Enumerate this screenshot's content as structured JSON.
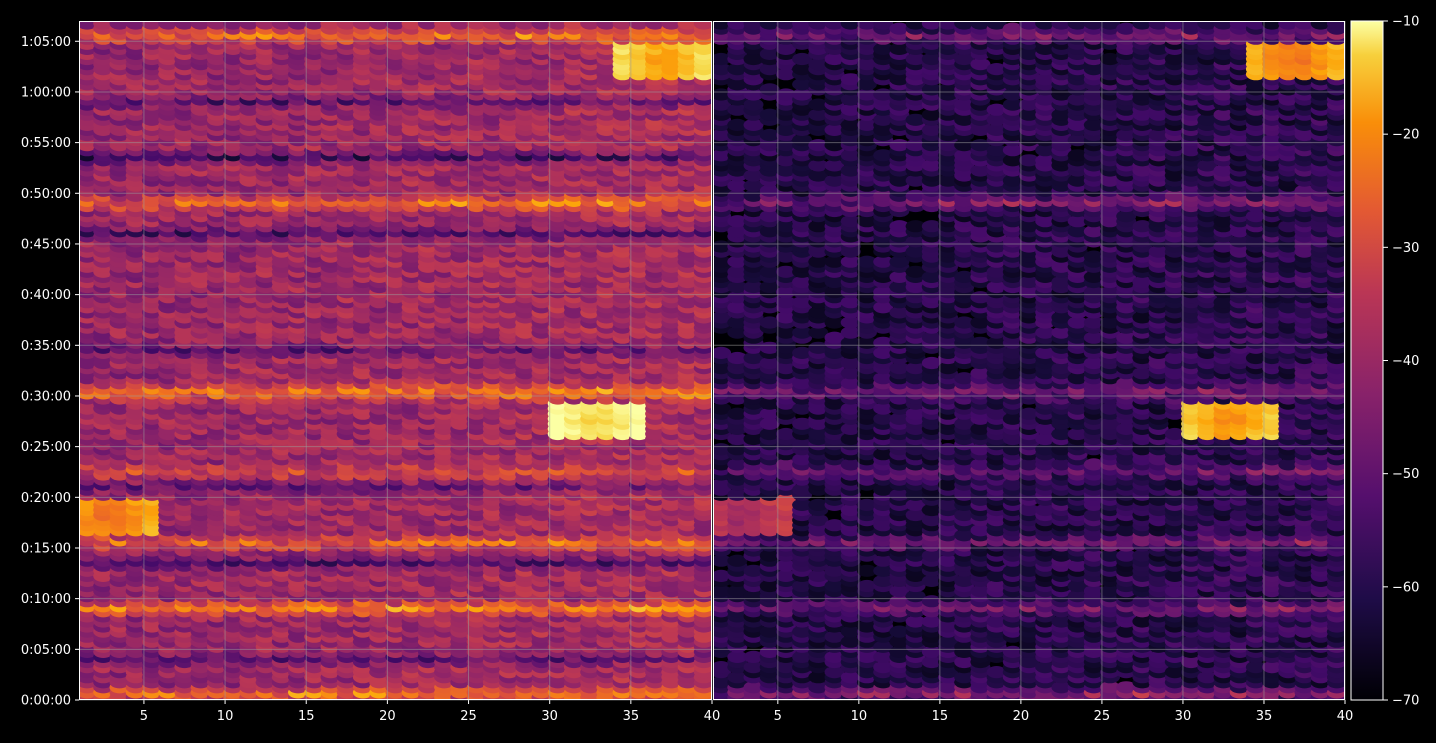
{
  "chart_data": [
    {
      "type": "heatmap",
      "panel": "left",
      "title": "",
      "xlabel": "",
      "ylabel": "",
      "xlim": [
        1,
        40
      ],
      "ylim_seconds": [
        0,
        4020
      ],
      "x_ticks": [
        5,
        10,
        15,
        20,
        25,
        30,
        35,
        40
      ],
      "x_tick_labels": [
        "5",
        "10",
        "15",
        "20",
        "25",
        "30",
        "35",
        "40"
      ],
      "y_ticks_seconds": [
        0,
        300,
        600,
        900,
        1200,
        1500,
        1800,
        2100,
        2400,
        2700,
        3000,
        3300,
        3600,
        3900
      ],
      "y_tick_labels": [
        "0:00:00",
        "0:05:00",
        "0:10:00",
        "0:15:00",
        "0:20:00",
        "0:25:00",
        "0:30:00",
        "0:35:00",
        "0:40:00",
        "0:45:00",
        "0:50:00",
        "0:55:00",
        "1:00:00",
        "1:05:00"
      ],
      "grid": true,
      "value_range": [
        -70,
        -10
      ],
      "baseline": -46,
      "time_events": [
        {
          "time": "0:00:30",
          "delta": 18
        },
        {
          "time": "0:09:00",
          "delta": 20
        },
        {
          "time": "0:15:30",
          "delta": 14
        },
        {
          "time": "0:22:30",
          "delta": 10
        },
        {
          "time": "0:30:20",
          "delta": 20
        },
        {
          "time": "0:49:00",
          "delta": 16
        },
        {
          "time": "1:05:30",
          "delta": 16
        }
      ],
      "low_bands": [
        {
          "time": "0:04:00",
          "delta": -10
        },
        {
          "time": "0:13:30",
          "delta": -12
        },
        {
          "time": "0:21:00",
          "delta": -8
        },
        {
          "time": "0:34:30",
          "delta": -9
        },
        {
          "time": "0:46:00",
          "delta": -12
        },
        {
          "time": "0:53:30",
          "delta": -14
        },
        {
          "time": "0:59:00",
          "delta": -10
        }
      ],
      "hotspots": [
        {
          "x": 33,
          "time": "0:27:30",
          "value": -20
        },
        {
          "x": 3,
          "time": "0:18:00",
          "value": -32
        },
        {
          "x": 37,
          "time": "1:03:00",
          "value": -26
        }
      ]
    },
    {
      "type": "heatmap",
      "panel": "right",
      "title": "",
      "xlabel": "",
      "ylabel": "",
      "xlim": [
        1,
        40
      ],
      "ylim_seconds": [
        0,
        4020
      ],
      "x_ticks": [
        5,
        10,
        15,
        20,
        25,
        30,
        35,
        40
      ],
      "x_tick_labels": [
        "5",
        "10",
        "15",
        "20",
        "25",
        "30",
        "35",
        "40"
      ],
      "grid": true,
      "value_range": [
        -70,
        -10
      ],
      "baseline": -64,
      "time_events": [
        {
          "time": "0:00:30",
          "delta": 16
        },
        {
          "time": "0:09:00",
          "delta": 12
        },
        {
          "time": "0:15:30",
          "delta": 12
        },
        {
          "time": "0:22:30",
          "delta": 10
        },
        {
          "time": "0:30:20",
          "delta": 14
        },
        {
          "time": "0:49:00",
          "delta": 14
        },
        {
          "time": "1:05:30",
          "delta": 12
        }
      ],
      "hotspots": [
        {
          "x": 33,
          "time": "0:27:30",
          "value": -28
        },
        {
          "x": 3,
          "time": "0:18:00",
          "value": -48
        },
        {
          "x": 37,
          "time": "1:03:00",
          "value": -32
        }
      ]
    }
  ],
  "colorbar": {
    "colormap": "inferno",
    "min": -70,
    "max": -10,
    "ticks": [
      -70,
      -60,
      -50,
      -40,
      -30,
      -20,
      -10
    ],
    "tick_labels": [
      "−70",
      "−60",
      "−50",
      "−40",
      "−30",
      "−20",
      "−10"
    ]
  },
  "colors": {
    "background": "#000000",
    "axes_frame": "#ffffff",
    "grid": "#9a9a9a"
  }
}
